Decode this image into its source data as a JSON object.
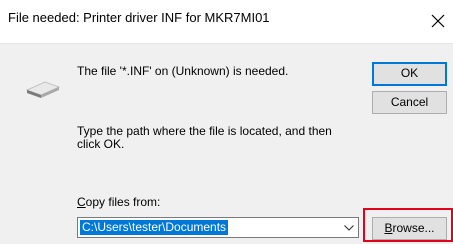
{
  "dialog": {
    "title": "File needed: Printer driver INF for MKR7MI01",
    "message": "The file '*.INF' on (Unknown) is needed.",
    "instruction": "Type the path where the file is located, and then click OK.",
    "ok_label": "OK",
    "cancel_label": "Cancel",
    "copy_label_mnemonic": "C",
    "copy_label_rest": "opy files from:",
    "path_value": "C:\\Users\\tester\\Documents",
    "browse_mnemonic": "B",
    "browse_rest": "rowse..."
  },
  "icons": [
    "close-icon",
    "drive-icon",
    "chevron-down-icon"
  ],
  "colors": {
    "accent": "#0078d7",
    "highlight": "#e3001b",
    "button_face": "#e1e1e1",
    "dialog_background": "#f0f0f0"
  }
}
